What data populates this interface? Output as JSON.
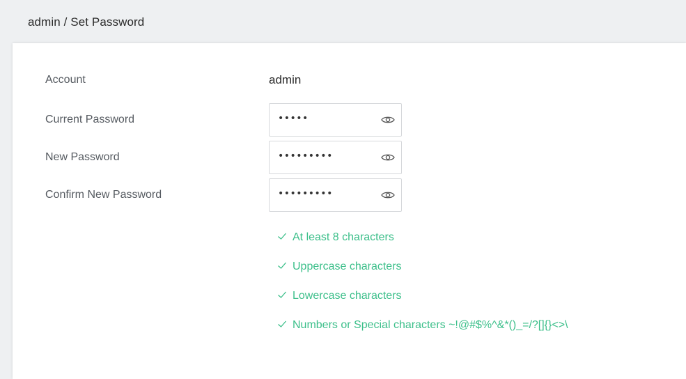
{
  "breadcrumb": "admin / Set Password",
  "form": {
    "account": {
      "label": "Account",
      "value": "admin"
    },
    "current_password": {
      "label": "Current Password",
      "masked_value": "•••••"
    },
    "new_password": {
      "label": "New Password",
      "masked_value": "•••••••••"
    },
    "confirm_password": {
      "label": "Confirm New Password",
      "masked_value": "•••••••••"
    }
  },
  "requirements": [
    "At least 8 characters",
    "Uppercase characters",
    "Lowercase characters",
    "Numbers or Special characters ~!@#$%^&*()_=/?[]{}<>\\"
  ],
  "colors": {
    "requirement_met": "#3cbf8a",
    "label": "#555a60",
    "background": "#eef0f2",
    "card": "#ffffff"
  },
  "icons": {
    "toggle_visibility": "eye-icon",
    "requirement_status": "check-icon"
  }
}
